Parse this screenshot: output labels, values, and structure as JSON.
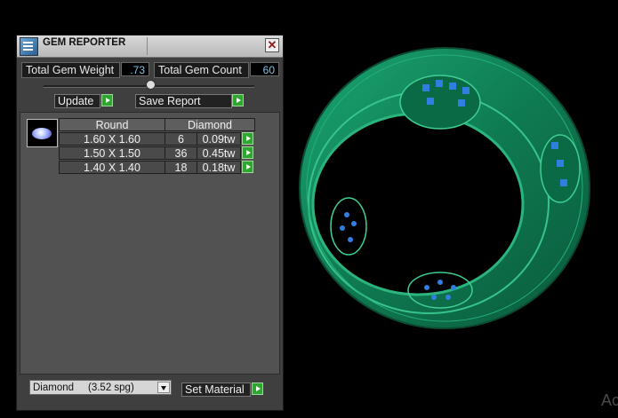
{
  "panel": {
    "title": "GEM REPORTER",
    "close_glyph": "✕",
    "total_weight_label": "Total Gem Weight",
    "total_weight_value": ".73",
    "total_count_label": "Total Gem Count",
    "total_count_value": "60",
    "update_label": "Update",
    "save_report_label": "Save Report"
  },
  "table": {
    "headers": [
      "Round",
      "Diamond"
    ],
    "rows": [
      {
        "size": "1.60 X 1.60",
        "count": "6",
        "weight": "0.09tw"
      },
      {
        "size": "1.50 X 1.50",
        "count": "36",
        "weight": "0.45tw"
      },
      {
        "size": "1.40 X 1.40",
        "count": "18",
        "weight": "0.18tw"
      }
    ]
  },
  "material": {
    "selected": "Diamond     (3.52 spg)",
    "set_material_label": "Set Material"
  },
  "watermark": "Ac",
  "colors": {
    "ring": "#0f7a52",
    "stones": "#2f7fe0",
    "accent_button": "#2fa62f"
  },
  "icons": [
    "gem-reporter-app-icon",
    "close-icon",
    "play-arrow-icon",
    "dropdown-arrow-icon",
    "round-gem-icon"
  ]
}
